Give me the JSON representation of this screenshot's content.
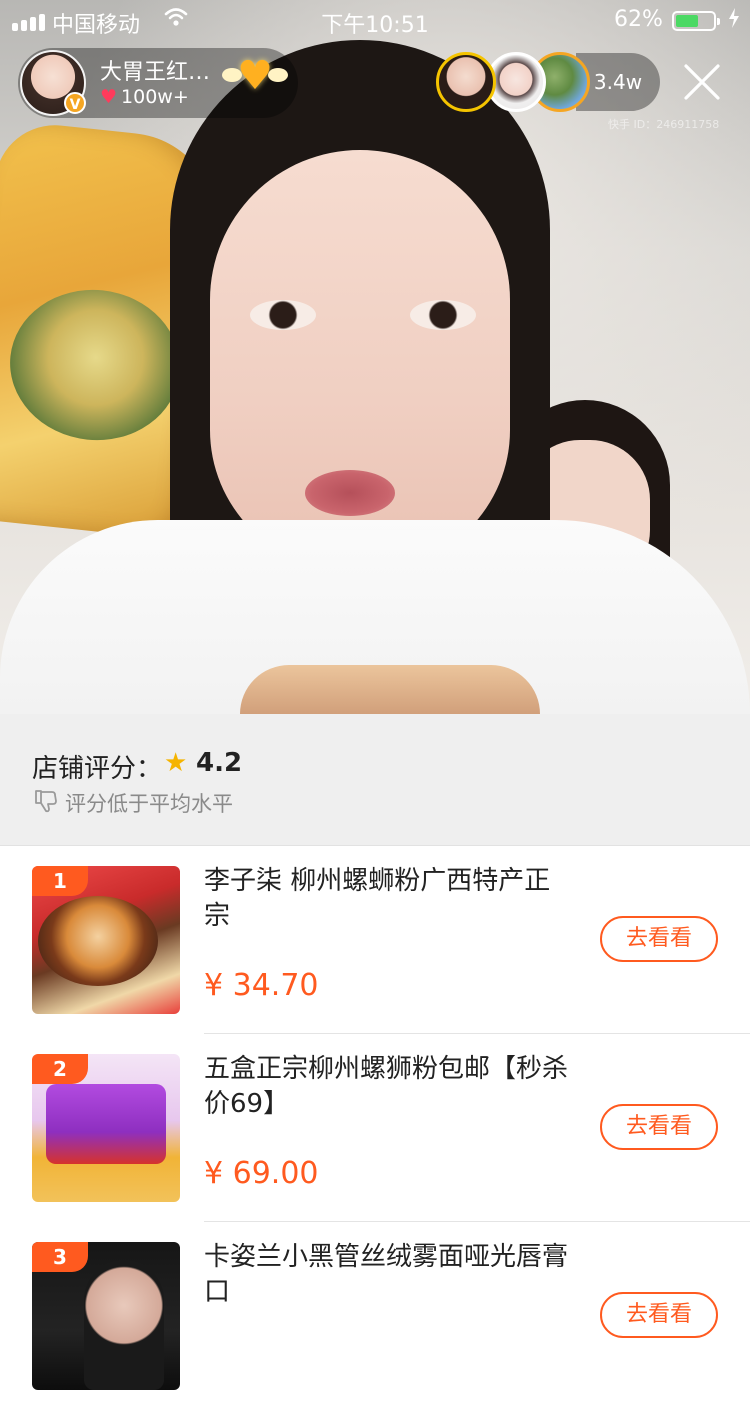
{
  "status_bar": {
    "carrier": "中国移动",
    "time": "下午10:51",
    "battery_percent": "62%",
    "battery_level": 0.62
  },
  "live_header": {
    "host_name": "大胃王红…",
    "likes": "100w+",
    "viewer_count": "3.4w",
    "watermark": "快手 ID：246911758",
    "viewers": [
      "viewer-avatar-1",
      "viewer-avatar-2",
      "viewer-avatar-3"
    ]
  },
  "store_rating": {
    "label": "店铺评分：",
    "score": "4.2",
    "note": "评分低于平均水平"
  },
  "products": [
    {
      "rank": "1",
      "title": "李子柒 柳州螺蛳粉广西特产正宗",
      "price": "¥ 34.70",
      "button": "去看看"
    },
    {
      "rank": "2",
      "title": "五盒正宗柳州螺狮粉包邮【秒杀价69】",
      "price": "¥ 69.00",
      "button": "去看看"
    },
    {
      "rank": "3",
      "title": "卡姿兰小黑管丝绒雾面哑光唇膏口",
      "price": "",
      "button": "去看看"
    }
  ],
  "colors": {
    "accent": "#ff5a1f",
    "star": "#f5b400",
    "battery": "#4cd964"
  },
  "icons": {
    "wifi": "wifi-icon",
    "heart": "heart-icon",
    "star": "star-icon",
    "thumb_down": "thumb-down-icon",
    "close": "close-icon"
  }
}
